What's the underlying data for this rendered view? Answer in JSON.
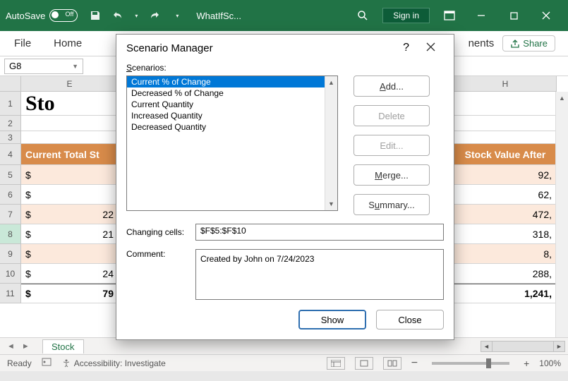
{
  "titlebar": {
    "autosave_label": "AutoSave",
    "autosave_state": "Off",
    "doc_title": "WhatIfSc...",
    "signin_label": "Sign in"
  },
  "ribbon": {
    "tabs": [
      "File",
      "Home"
    ],
    "trunc_right": "nents",
    "share_label": "Share"
  },
  "fbar": {
    "namebox_value": "G8"
  },
  "grid": {
    "col_letters": {
      "E": "E",
      "H": "H"
    },
    "row_nums": [
      "1",
      "2",
      "3",
      "4",
      "5",
      "6",
      "7",
      "8",
      "9",
      "10",
      "11"
    ],
    "title_text": "Sto",
    "headers": {
      "E": "Current Total St",
      "H": "Stock Value After"
    },
    "rows": [
      {
        "E_prefix": "$",
        "E_rest": "",
        "H": "92,"
      },
      {
        "E_prefix": "$",
        "E_rest": "",
        "H": "62,"
      },
      {
        "E_prefix": "$",
        "E_rest": "22",
        "H": "472,"
      },
      {
        "E_prefix": "$",
        "E_rest": "21",
        "H": "318,"
      },
      {
        "E_prefix": "$",
        "E_rest": "",
        "H": "8,"
      },
      {
        "E_prefix": "$",
        "E_rest": "24",
        "H": "288,"
      },
      {
        "E_prefix": "$",
        "E_rest": "79",
        "H": "1,241,"
      }
    ]
  },
  "sheet_tabs": {
    "active": "Stock"
  },
  "status": {
    "ready": "Ready",
    "accessibility": "Accessibility: Investigate",
    "zoom": "100%"
  },
  "dialog": {
    "title": "Scenario Manager",
    "help": "?",
    "scenarios_label": "Scenarios:",
    "items": [
      "Current % of Change",
      "Decreased % of Change",
      "Current Quantity",
      "Increased Quantity",
      "Decreased Quantity"
    ],
    "selected_index": 0,
    "buttons": {
      "add": "Add...",
      "delete": "Delete",
      "edit": "Edit...",
      "merge": "Merge...",
      "summary": "Summary..."
    },
    "changing_label": "Changing cells:",
    "changing_value": "$F$5:$F$10",
    "comment_label": "Comment:",
    "comment_value": "Created by John on 7/24/2023",
    "show": "Show",
    "close": "Close"
  }
}
